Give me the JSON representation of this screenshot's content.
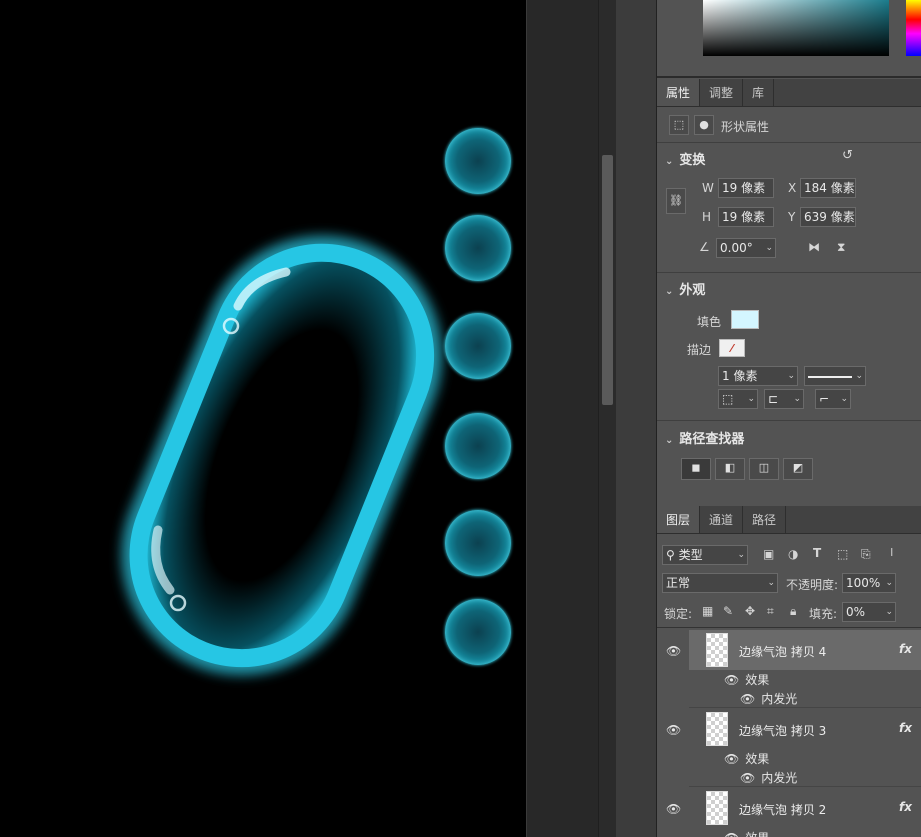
{
  "properties_tabs": [
    "属性",
    "调整",
    "库"
  ],
  "shape_props_label": "形状属性",
  "transform": {
    "title": "变换",
    "w_label": "W",
    "w_value": "19 像素",
    "x_label": "X",
    "x_value": "184 像素",
    "h_label": "H",
    "h_value": "19 像素",
    "y_label": "Y",
    "y_value": "639 像素",
    "angle_value": "0.00°"
  },
  "appearance": {
    "title": "外观",
    "fill_label": "填色",
    "fill_color": "#d4f6ff",
    "stroke_label": "描边",
    "stroke_width": "1 像素"
  },
  "pathfinder": {
    "title": "路径查找器"
  },
  "layers_tabs": [
    "图层",
    "通道",
    "路径"
  ],
  "layers_filter": {
    "kind_label": "类型",
    "blend_mode": "正常",
    "opacity_label": "不透明度:",
    "opacity_value": "100%",
    "lock_label": "锁定:",
    "fill_label": "填充:",
    "fill_value": "0%"
  },
  "layers": [
    {
      "name": "边缘气泡 拷贝 4",
      "fx": "fx",
      "effects_label": "效果",
      "effect_item": "内发光",
      "selected": true
    },
    {
      "name": "边缘气泡 拷贝 3",
      "fx": "fx",
      "effects_label": "效果",
      "effect_item": "内发光",
      "selected": false
    },
    {
      "name": "边缘气泡 拷贝 2",
      "fx": "fx",
      "effects_label": "效果",
      "effect_item": "",
      "selected": false
    }
  ],
  "colors": {
    "glow": "#2fd0ec",
    "canvas": "#000000",
    "panel": "#535353"
  }
}
